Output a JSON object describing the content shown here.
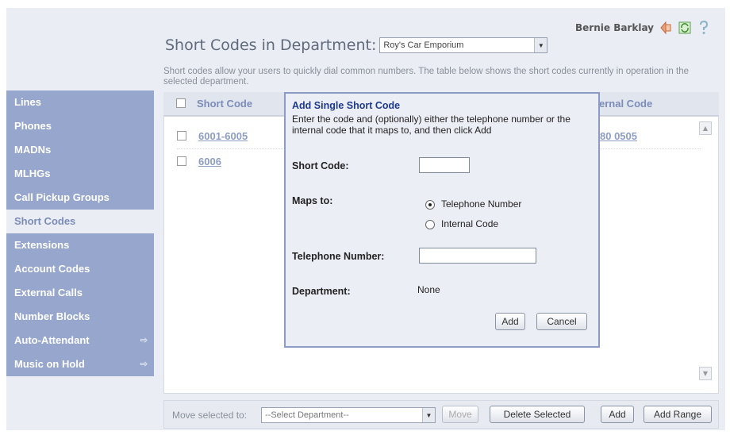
{
  "header": {
    "user_name": "Bernie Barklay",
    "icons": [
      "logout-icon",
      "refresh-icon",
      "help-icon"
    ]
  },
  "page": {
    "title": "Short Codes in Department:",
    "department_selected": "Roy's Car Emporium",
    "description": "Short codes allow your users to quickly dial common numbers. The table below shows the short codes currently in operation in the selected department."
  },
  "sidebar": {
    "items": [
      {
        "label": "Lines"
      },
      {
        "label": "Phones"
      },
      {
        "label": "MADNs"
      },
      {
        "label": "MLHGs"
      },
      {
        "label": "Call Pickup Groups"
      },
      {
        "label": "Short Codes",
        "active": true
      },
      {
        "label": "Extensions"
      },
      {
        "label": "Account Codes"
      },
      {
        "label": "External Calls"
      },
      {
        "label": "Number Blocks"
      },
      {
        "label": "Auto-Attendant",
        "submenu": true
      },
      {
        "label": "Music on Hold",
        "submenu": true
      }
    ]
  },
  "table": {
    "columns": [
      "Short Code",
      "ernal Code"
    ],
    "rows": [
      {
        "short_code": "6001-6005",
        "internal_code": "80 0505"
      },
      {
        "short_code": "6006",
        "internal_code": ""
      }
    ]
  },
  "footer": {
    "move_label": "Move selected to:",
    "move_placeholder": "--Select Department--",
    "move_button": "Move",
    "delete_button": "Delete Selected",
    "add_button": "Add",
    "add_range_button": "Add Range"
  },
  "modal": {
    "title": "Add  Single Short Code",
    "description": "Enter the code and (optionally) either the telephone number or the internal code that it maps to, and then click Add",
    "short_code_label": "Short Code:",
    "short_code_value": "",
    "maps_to_label": "Maps to:",
    "option_telephone": "Telephone Number",
    "option_internal": "Internal Code",
    "selected_option": "Telephone Number",
    "telephone_label": "Telephone Number:",
    "telephone_value": "",
    "department_label": "Department:",
    "department_value": "None",
    "add_button": "Add",
    "cancel_button": "Cancel"
  },
  "colors": {
    "sidebar": "#96a6cd",
    "accent_text": "#7b8cb8",
    "modal_title": "#1f3a8c",
    "modal_border": "#8b9bc6"
  }
}
